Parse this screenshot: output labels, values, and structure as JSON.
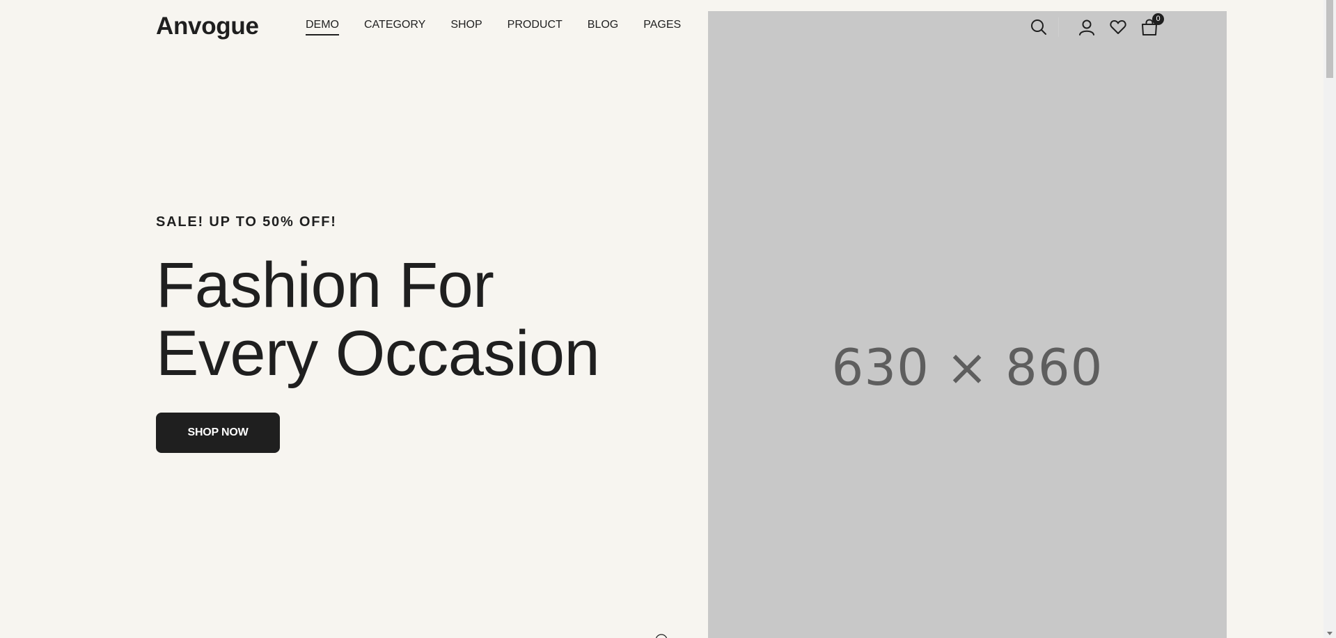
{
  "header": {
    "logo": "Anvogue",
    "nav": [
      {
        "label": "DEMO",
        "active": true
      },
      {
        "label": "CATEGORY",
        "active": false
      },
      {
        "label": "SHOP",
        "active": false
      },
      {
        "label": "PRODUCT",
        "active": false
      },
      {
        "label": "BLOG",
        "active": false
      },
      {
        "label": "PAGES",
        "active": false
      }
    ],
    "icons": [
      "search-icon",
      "user-icon",
      "heart-icon",
      "cart-icon"
    ],
    "cart_count": "0"
  },
  "hero": {
    "eyebrow": "SALE! UP TO 50% OFF!",
    "headline_line1": "Fashion For",
    "headline_line2": "Every Occasion",
    "cta_label": "SHOP NOW",
    "image_placeholder_label": "630 × 860"
  },
  "colors": {
    "background": "#f7f5f0",
    "text": "#1f1f1f",
    "placeholder": "#c8c8c8",
    "button": "#1f1f1f"
  }
}
